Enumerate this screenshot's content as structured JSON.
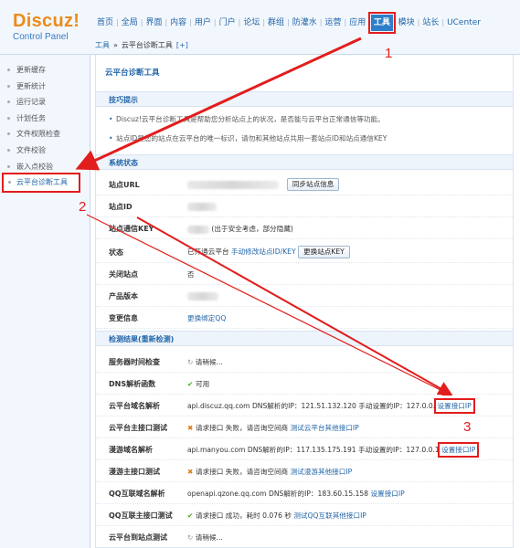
{
  "logo": {
    "main": "Discuz!",
    "sub": "Control Panel"
  },
  "topnav": [
    "首页",
    "全局",
    "界面",
    "内容",
    "用户",
    "门户",
    "论坛",
    "群组",
    "防灌水",
    "运营",
    "应用",
    "工具",
    "模块",
    "站长",
    "UCenter"
  ],
  "breadcrumb": {
    "parent": "工具",
    "sep": "»",
    "current": "云平台诊断工具",
    "add": "[+]"
  },
  "sidebar": [
    "更新缓存",
    "更新统计",
    "运行记录",
    "计划任务",
    "文件权限检查",
    "文件校验",
    "嵌入点校验",
    "云平台诊断工具"
  ],
  "page_heading": "云平台诊断工具",
  "tips": {
    "title": "技巧提示",
    "items": [
      "Discuz!云平台诊断工具是帮助您分析站点上的状况，是否能与云平台正常通信等功能。",
      "站点ID是您的站点在云平台的唯一标识，请勿和其他站点共用一套站点ID和站点通信KEY"
    ]
  },
  "status": {
    "title": "系统状态",
    "site_url_label": "站点URL",
    "site_url_suffix": "",
    "sync_btn": "同步站点信息",
    "site_id_label": "站点ID",
    "key_label": "站点通信KEY",
    "key_note": "(出于安全考虑，部分隐藏)",
    "state_label": "状态",
    "state_value": "已开通云平台",
    "state_link": "手动修改站点ID/KEY",
    "change_key_btn": "更换站点KEY",
    "closed_label": "关闭站点",
    "closed_value": "否",
    "version_label": "产品版本",
    "bind_label": "变更信息",
    "bind_link": "更换绑定QQ"
  },
  "check": {
    "title": "检测结果(重新检测)",
    "rows": [
      {
        "label": "服务器时间检查",
        "icon": "spinner-icon",
        "text": "请稍候...",
        "link": ""
      },
      {
        "label": "DNS解析函数",
        "icon": "check-icon",
        "text": "可用",
        "link": ""
      },
      {
        "label": "云平台域名解析",
        "icon": "",
        "text": "api.discuz.qq.com DNS解析的IP：121.51.132.120 手动设置的IP：127.0.0.",
        "link": "设置接口IP"
      },
      {
        "label": "云平台主接口测试",
        "icon": "cross-icon",
        "text": "请求接口 失败，请咨询空间商",
        "link": "测试云平台其他接口IP"
      },
      {
        "label": "漫游域名解析",
        "icon": "",
        "text": "api.manyou.com DNS解析的IP：117.135.175.191 手动设置的IP：127.0.0.1",
        "link": "设置接口IP"
      },
      {
        "label": "漫游主接口测试",
        "icon": "cross-icon",
        "text": "请求接口 失败，请咨询空间商",
        "link": "测试漫游其他接口IP"
      },
      {
        "label": "QQ互联域名解析",
        "icon": "",
        "text": "openapi.qzone.qq.com DNS解析的IP：183.60.15.158",
        "link": "设置接口IP"
      },
      {
        "label": "QQ互联主接口测试",
        "icon": "check-icon",
        "text": "请求接口 成功，耗时 0.076 秒",
        "link": "测试QQ互联其他接口IP"
      },
      {
        "label": "云平台到站点测试",
        "icon": "spinner-icon",
        "text": "请稍候...",
        "link": ""
      }
    ]
  },
  "annotations": [
    "1",
    "2",
    "3"
  ],
  "colors": {
    "accent": "#2366a8",
    "highlight": "#e21d1d",
    "logo": "#ec8b1a"
  }
}
